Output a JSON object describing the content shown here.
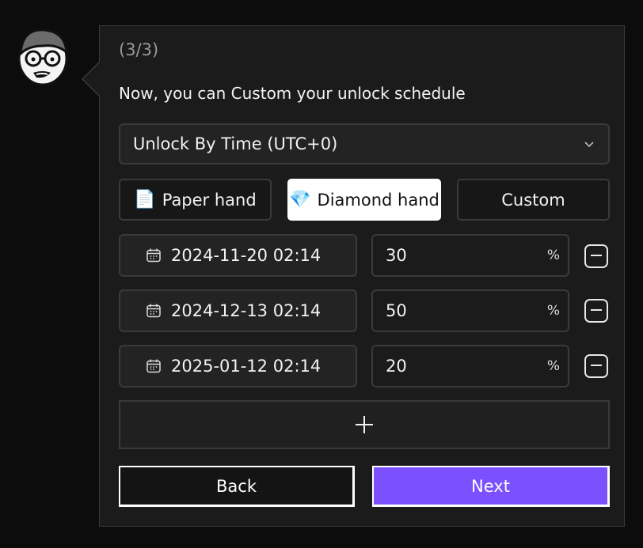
{
  "dialog": {
    "step_label": "(3/3)",
    "prompt": "Now, you can Custom your unlock schedule",
    "unlock_mode": {
      "selected": "Unlock By Time (UTC+0)",
      "icon": "chevron-down-icon"
    },
    "presets": [
      {
        "label": "Paper hand",
        "emoji": "📄",
        "active": false
      },
      {
        "label": "Diamond hand",
        "emoji": "💎",
        "active": true
      },
      {
        "label": "Custom",
        "emoji": "",
        "active": false
      }
    ],
    "schedule": [
      {
        "date": "2024-11-20 02:14",
        "percent": "30",
        "unit": "%"
      },
      {
        "date": "2024-12-13 02:14",
        "percent": "50",
        "unit": "%"
      },
      {
        "date": "2025-01-12 02:14",
        "percent": "20",
        "unit": "%"
      }
    ],
    "add_icon": "plus-icon",
    "back_label": "Back",
    "next_label": "Next",
    "accent_color": "#7a50ff"
  }
}
